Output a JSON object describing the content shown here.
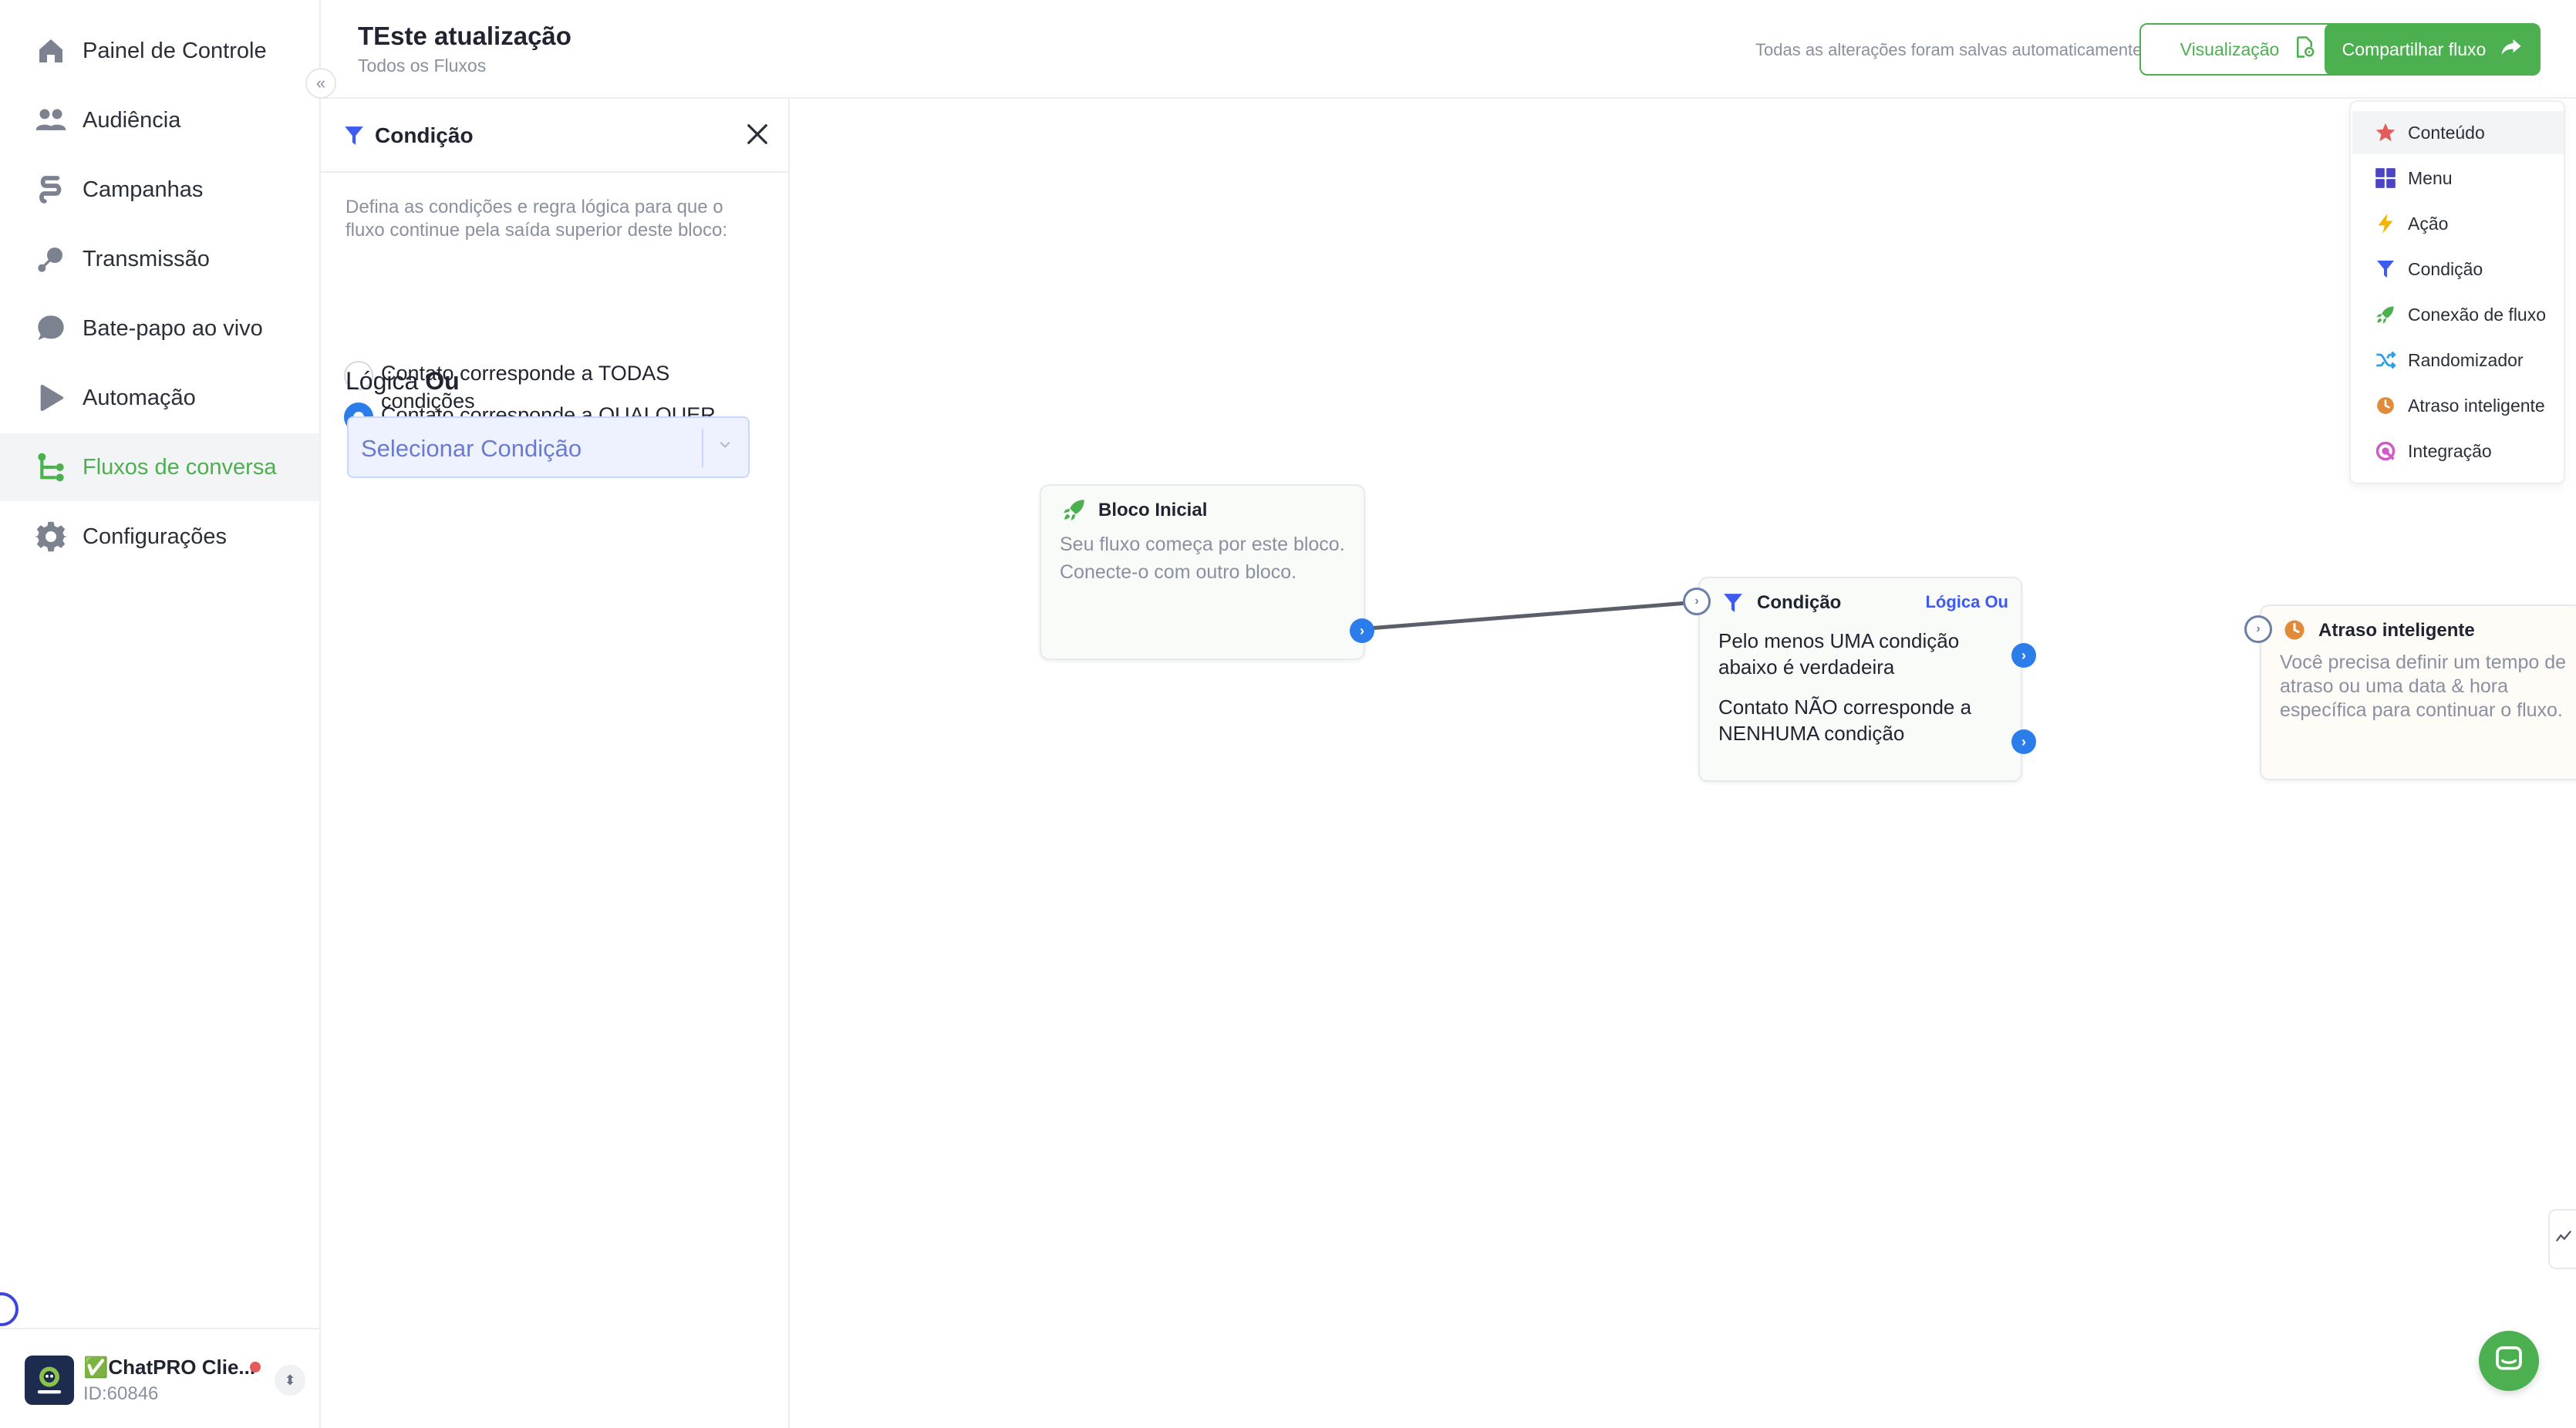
{
  "sidebar": {
    "items": [
      {
        "label": "Painel de Controle",
        "icon": "home-icon"
      },
      {
        "label": "Audiência",
        "icon": "users-icon"
      },
      {
        "label": "Campanhas",
        "icon": "campaign-icon"
      },
      {
        "label": "Transmissão",
        "icon": "broadcast-icon"
      },
      {
        "label": "Bate-papo ao vivo",
        "icon": "chat-bubble-icon"
      },
      {
        "label": "Automação",
        "icon": "play-icon"
      },
      {
        "label": "Fluxos de conversa",
        "icon": "flow-icon"
      },
      {
        "label": "Configurações",
        "icon": "gear-icon"
      }
    ],
    "active_index": 6,
    "account": {
      "name": "✅ChatPRO Clie...",
      "id": "ID:60846",
      "status_color": "#e25c5c"
    }
  },
  "header": {
    "title": "TEste atualização",
    "breadcrumb": "Todos os Fluxos",
    "autosave": "Todas as alterações foram salvas automaticamente",
    "preview_label": "Visualização",
    "share_label": "Compartilhar fluxo"
  },
  "condition_panel": {
    "title": "Condição",
    "description": "Defina as condições e regra lógica para que o fluxo continue pela saída superior deste bloco:",
    "option_all": "Contato corresponde a TODAS condições",
    "option_any": "Contato corresponde a QUALQUER condição",
    "selected_option": "any",
    "logic_prefix": "Lógica",
    "logic_value": "Ou",
    "select_placeholder": "Selecionar Condição"
  },
  "canvas": {
    "start_block": {
      "title": "Bloco Inicial",
      "text": "Seu fluxo começa por este bloco. Conecte-o com outro bloco."
    },
    "condition_block": {
      "title": "Condição",
      "logic_badge": "Lógica Ou",
      "true_text": "Pelo menos UMA condição abaixo é verdadeira",
      "false_text": "Contato NÃO corresponde a NENHUMA condição"
    },
    "delay_block": {
      "title": "Atraso inteligente",
      "text": "Você precisa definir um tempo de atraso ou uma data & hora específica para continuar o fluxo."
    }
  },
  "block_menu": {
    "items": [
      {
        "label": "Conteúdo",
        "icon": "star-icon"
      },
      {
        "label": "Menu",
        "icon": "grid-icon"
      },
      {
        "label": "Ação",
        "icon": "lightning-icon"
      },
      {
        "label": "Condição",
        "icon": "filter-icon"
      },
      {
        "label": "Conexão de fluxo",
        "icon": "rocket-icon"
      },
      {
        "label": "Randomizador",
        "icon": "shuffle-icon"
      },
      {
        "label": "Atraso inteligente",
        "icon": "clock-icon"
      },
      {
        "label": "Integração",
        "icon": "integration-icon"
      }
    ],
    "highlighted_index": 0
  },
  "colors": {
    "brand_green": "#4caf50",
    "port_blue": "#2b7de9",
    "filter_blue": "#3d5af1"
  }
}
